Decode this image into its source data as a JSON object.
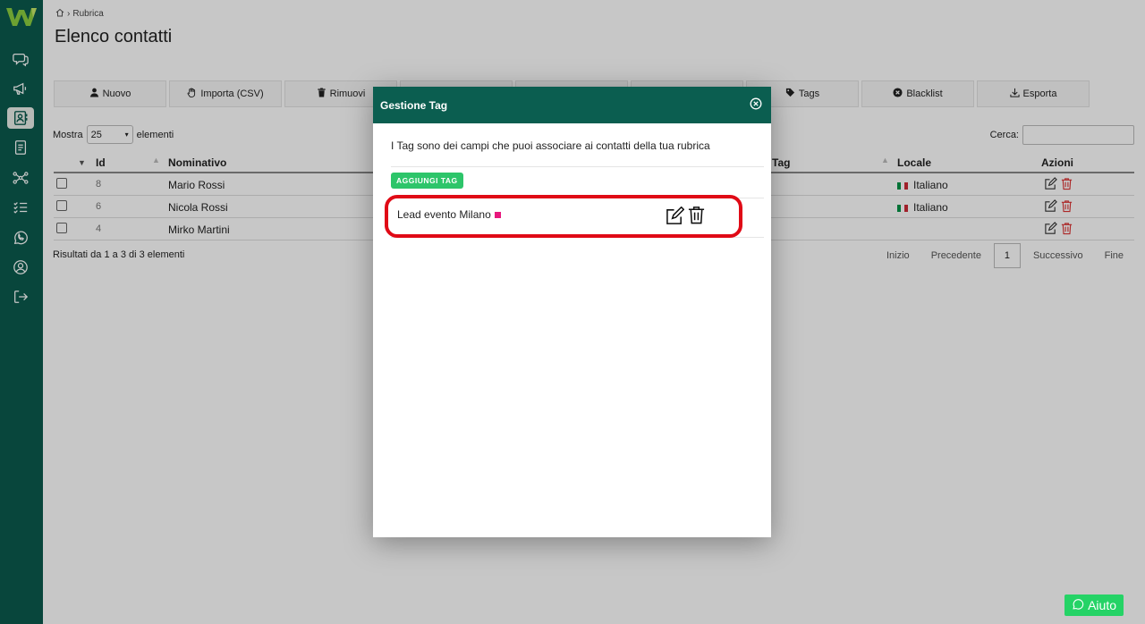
{
  "breadcrumb": {
    "label": "Rubrica"
  },
  "page": {
    "title": "Elenco contatti"
  },
  "toolbar": {
    "new_label": "Nuovo",
    "import_label": "Importa (CSV)",
    "remove_label": "Rimuovi",
    "tags_label": "Tags",
    "blacklist_label": "Blacklist",
    "export_label": "Esporta"
  },
  "table_controls": {
    "show_label": "Mostra",
    "page_size": "25",
    "elements_label": "elementi",
    "search_label": "Cerca:"
  },
  "table": {
    "headers": {
      "id": "Id",
      "name": "Nominativo",
      "tag": "Tag",
      "locale": "Locale",
      "actions": "Azioni"
    },
    "rows": [
      {
        "id": "8",
        "name": "Mario Rossi",
        "locale": "Italiano"
      },
      {
        "id": "6",
        "name": "Nicola Rossi",
        "locale": "Italiano"
      },
      {
        "id": "4",
        "name": "Mirko Martini",
        "locale": ""
      }
    ]
  },
  "results": {
    "text": "Risultati da 1 a 3 di 3 elementi"
  },
  "pagination": {
    "first": "Inizio",
    "prev": "Precedente",
    "current": "1",
    "next": "Successivo",
    "last": "Fine"
  },
  "help": {
    "label": "Aiuto"
  },
  "modal": {
    "title": "Gestione Tag",
    "description": "I Tag sono dei campi che puoi associare ai contatti della tua rubrica",
    "add_tag_label": "AGGIUNGI TAG",
    "tags": [
      {
        "name": "Lead evento Milano",
        "color": "#e8177d"
      }
    ]
  },
  "colors": {
    "sidebar": "#0b5a4e",
    "modal_header": "#0b5e50",
    "add_tag": "#2dc56a",
    "help_button": "#25d366",
    "highlight": "#e00a16"
  },
  "icons": {
    "sidebar": [
      "logo",
      "chat-icon",
      "megaphone-icon",
      "contacts-icon",
      "document-icon",
      "flow-icon",
      "checklist-icon",
      "whatsapp-icon",
      "user-circle-icon",
      "logout-icon"
    ]
  }
}
